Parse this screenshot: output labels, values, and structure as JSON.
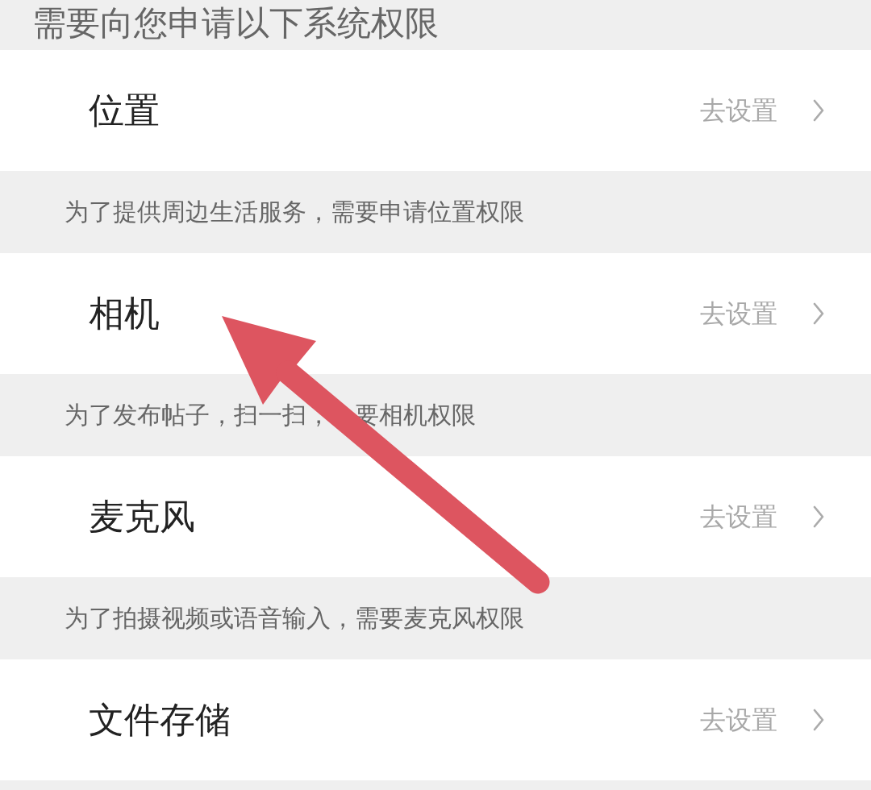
{
  "header": {
    "text": "需要向您申请以下系统权限"
  },
  "permissions": [
    {
      "name": "位置",
      "action": "去设置",
      "description": [
        "为了提供周边生活服务，需要申请位置权限"
      ]
    },
    {
      "name": "相机",
      "action": "去设置",
      "description": [
        "为了发布帖子，扫一扫，",
        "要相机权限"
      ]
    },
    {
      "name": "麦克风",
      "action": "去设置",
      "description": [
        "为了拍摄视频或语音输入，需要麦克风权限"
      ]
    },
    {
      "name": "文件存储",
      "action": "去设置"
    }
  ]
}
